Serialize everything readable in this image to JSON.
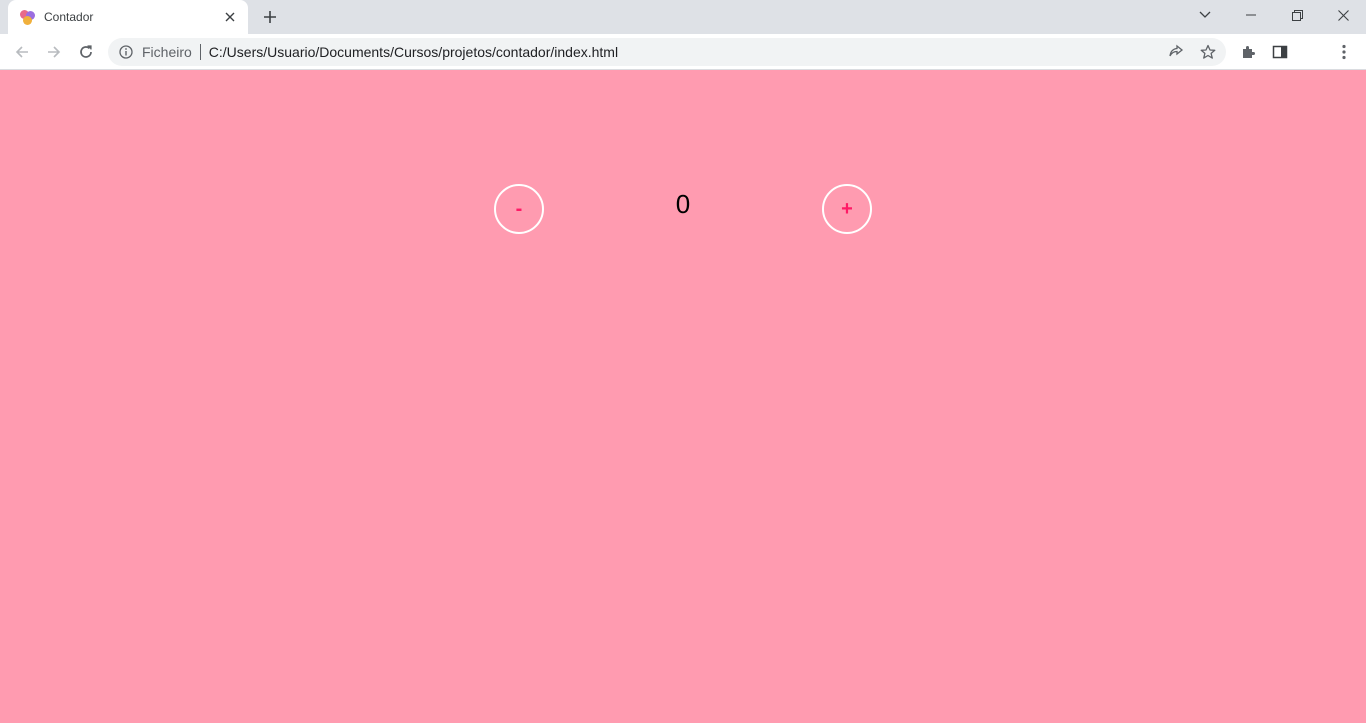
{
  "browser": {
    "tab": {
      "title": "Contador"
    },
    "address": {
      "scheme_label": "Ficheiro",
      "url": "C:/Users/Usuario/Documents/Cursos/projetos/contador/index.html"
    }
  },
  "page": {
    "background_color": "#ff9bb0",
    "accent_color": "#ff1a66",
    "counter": {
      "minus_label": "-",
      "value": "0",
      "plus_label": "+"
    }
  }
}
